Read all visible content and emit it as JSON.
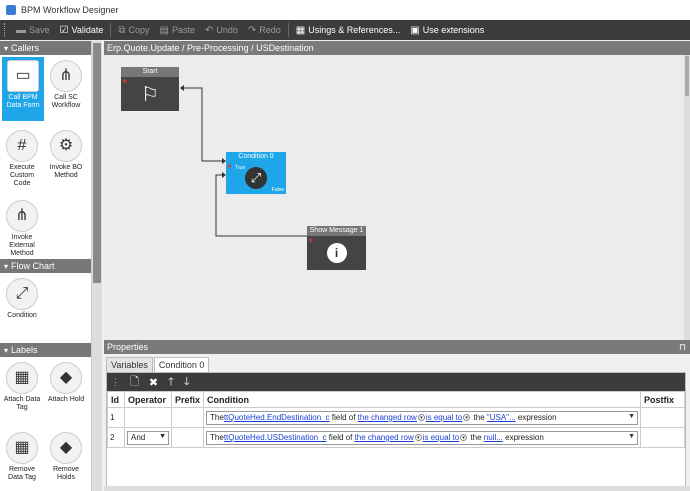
{
  "window": {
    "title": "BPM Workflow Designer"
  },
  "toolbar": {
    "save": "Save",
    "validate": "Validate",
    "copy": "Copy",
    "paste": "Paste",
    "undo": "Undo",
    "redo": "Redo",
    "usings": "Usings & References...",
    "use_ext": "Use extensions"
  },
  "toolbox": {
    "callers": {
      "label": "Callers",
      "items": [
        "Call BPM Data Form",
        "Call SC Workflow",
        "Execute Custom Code",
        "Invoke BO Method",
        "Invoke External Method"
      ]
    },
    "flowchart": {
      "label": "Flow Chart",
      "items": [
        "Condition"
      ]
    },
    "labels": {
      "label": "Labels",
      "items": [
        "Attach Data Tag",
        "Attach Hold",
        "Remove Data Tag",
        "Remove Holds"
      ]
    }
  },
  "breadcrumb": "Erp.Quote.Update / Pre-Processing / USDestination",
  "nodes": {
    "start": "Start",
    "condition": "Condition 0",
    "condition_true": "True",
    "condition_false": "False",
    "show_message": "Show Message 1"
  },
  "properties": {
    "title": "Properties",
    "pin": "⊓",
    "tabs": [
      "Variables",
      "Condition 0"
    ],
    "columns": [
      "Id",
      "Operator",
      "Prefix",
      "Condition",
      "Postfix"
    ],
    "rows": [
      {
        "id": "1",
        "operator": "",
        "c1": "The ",
        "c2": "ttQuoteHed.EndDestination_c",
        "c3": " field of ",
        "c4": "the changed row",
        "c5": "is equal to",
        "c6": " the ",
        "c7": "\"USA\"...",
        "c8": " expression"
      },
      {
        "id": "2",
        "operator": "And",
        "c1": "The ",
        "c2": "ttQuoteHed.USDestination_c",
        "c3": " field of ",
        "c4": "the changed row",
        "c5": "is equal to",
        "c6": " the ",
        "c7": "null...",
        "c8": " expression"
      }
    ]
  },
  "colors": {
    "accent": "#1ea6e8",
    "toolbar": "#3c3c3c",
    "panel": "#7a7a7a"
  }
}
